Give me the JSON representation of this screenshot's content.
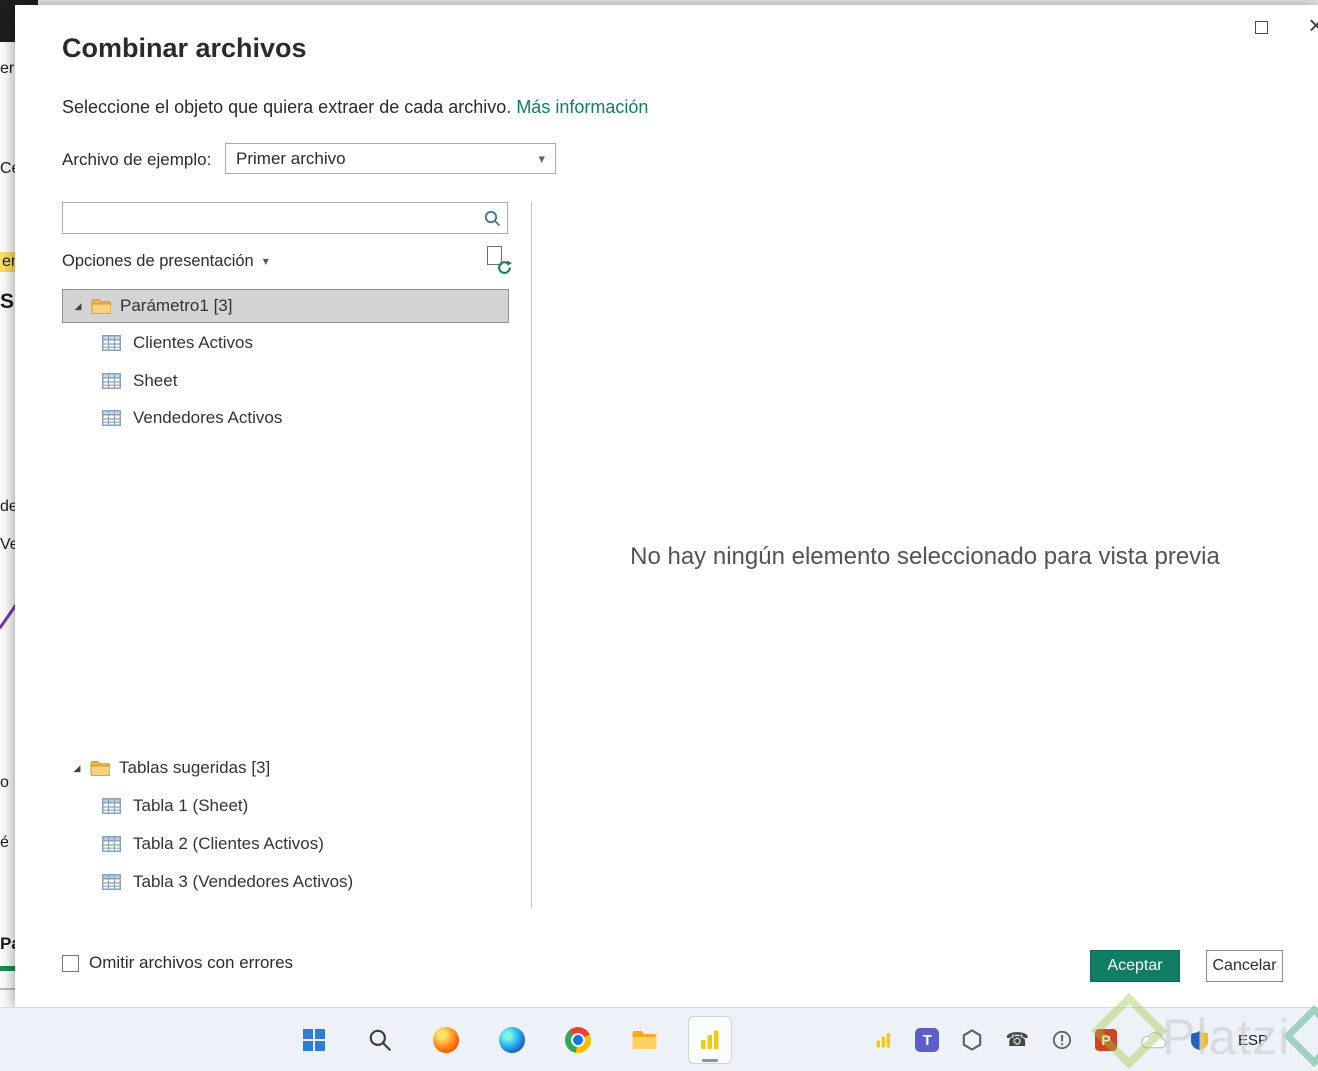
{
  "colors": {
    "accent": "#117d64",
    "link": "#117d64",
    "selection": "#d4d4d4",
    "taskbar": "#eef2f8"
  },
  "dialog": {
    "title": "Combinar archivos",
    "subtitle": "Seleccione el objeto que quiera extraer de cada archivo.",
    "more_info_link": "Más información",
    "example_label": "Archivo de ejemplo:",
    "example_value": "Primer archivo",
    "search_value": "",
    "display_options": "Opciones de presentación",
    "empty_preview": "No hay ningún elemento seleccionado para vista previa",
    "skip_errors": "Omitir archivos con errores",
    "accept": "Aceptar",
    "cancel": "Cancelar"
  },
  "tree": {
    "group1": {
      "label": "Parámetro1",
      "count": "[3]",
      "items": [
        "Clientes Activos",
        "Sheet",
        "Vendedores Activos"
      ]
    },
    "group2": {
      "label": "Tablas sugeridas",
      "count": "[3]",
      "items": [
        "Tabla 1 (Sheet)",
        "Tabla 2 (Clientes Activos)",
        "Tabla 3 (Vendedores Activos)"
      ]
    }
  },
  "background": {
    "fragments": [
      "er",
      "Cer",
      "ent",
      "Si",
      "de",
      "Ve",
      "o",
      "é",
      "Pá"
    ]
  },
  "taskbar": {
    "language": "ESP",
    "watermark": "Platzi"
  },
  "icons": {
    "chevron_down": "▾",
    "close": "×",
    "tree_expanded": "◢",
    "teams_letter": "T",
    "powerpoint_letter": "P",
    "phone": "☎"
  }
}
